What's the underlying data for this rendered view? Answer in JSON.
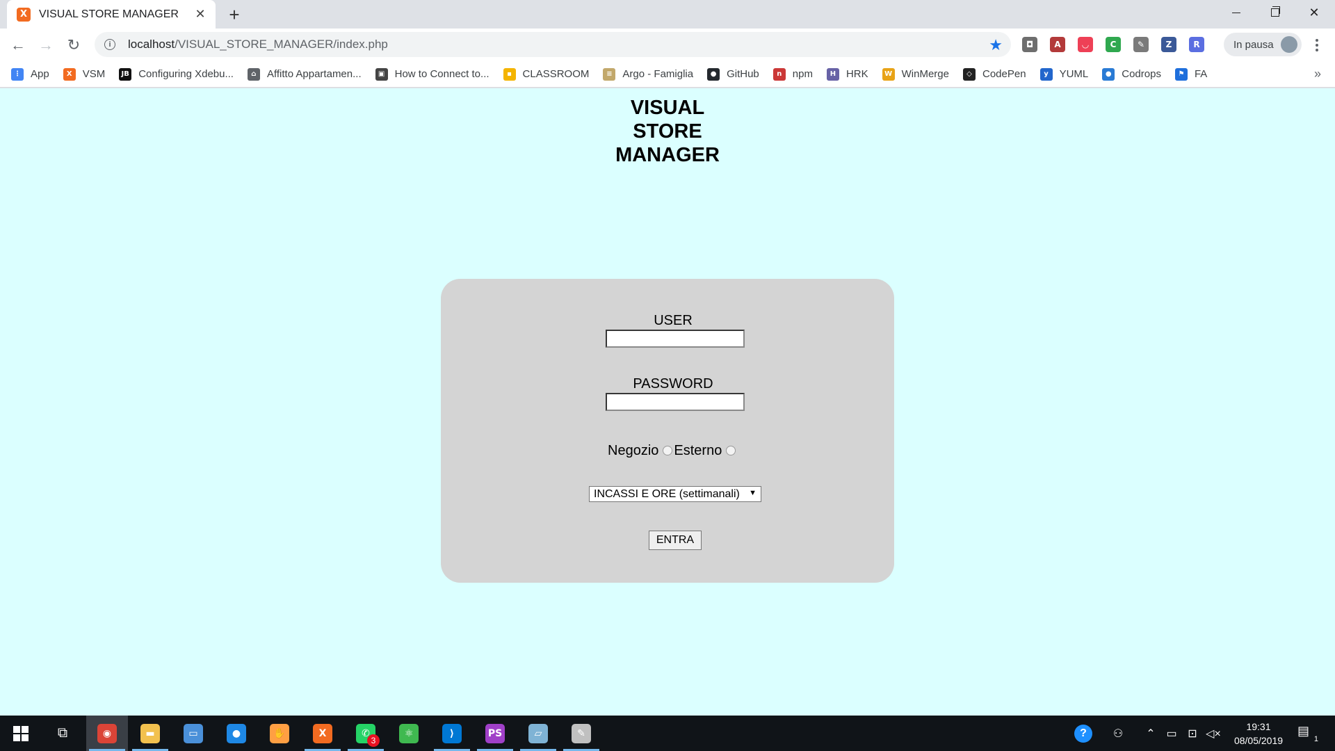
{
  "browser": {
    "tab_title": "VISUAL STORE MANAGER",
    "tab_favicon_letter": "X",
    "url_host": "localhost",
    "url_path": "/VISUAL_STORE_MANAGER/index.php",
    "profile_label": "In pausa",
    "extensions": [
      {
        "name": "camera-extension-icon",
        "glyph": "◘",
        "color": "#6e6e6e"
      },
      {
        "name": "pdf-extension-icon",
        "glyph": "A",
        "color": "#b33a3a"
      },
      {
        "name": "pocket-extension-icon",
        "glyph": "◡",
        "color": "#ee4056"
      },
      {
        "name": "cors-extension-icon",
        "glyph": "C",
        "color": "#2fa84f"
      },
      {
        "name": "tools-extension-icon",
        "glyph": "✎",
        "color": "#7a7a7a"
      },
      {
        "name": "zotero-extension-icon",
        "glyph": "Z",
        "color": "#3b5998"
      },
      {
        "name": "react-extension-icon",
        "glyph": "R",
        "color": "#5b6ee1"
      }
    ]
  },
  "bookmarks": [
    {
      "label": "App",
      "icon": "apps-grid-icon",
      "color": "#4285f4",
      "glyph": "⋮"
    },
    {
      "label": "VSM",
      "icon": "xampp-icon",
      "color": "#f26b21",
      "glyph": "X"
    },
    {
      "label": "Configuring Xdebu...",
      "icon": "jetbrains-icon",
      "color": "#111111",
      "glyph": "JB"
    },
    {
      "label": "Affitto Appartamen...",
      "icon": "house-icon",
      "color": "#5f6368",
      "glyph": "⌂"
    },
    {
      "label": "How to Connect to...",
      "icon": "floppy-icon",
      "color": "#444444",
      "glyph": "▣"
    },
    {
      "label": "CLASSROOM",
      "icon": "classroom-icon",
      "color": "#f4b400",
      "glyph": "▪"
    },
    {
      "label": "Argo - Famiglia",
      "icon": "argo-icon",
      "color": "#c2a86b",
      "glyph": "≡"
    },
    {
      "label": "GitHub",
      "icon": "github-icon",
      "color": "#24292e",
      "glyph": "●"
    },
    {
      "label": "npm",
      "icon": "npm-icon",
      "color": "#cb3837",
      "glyph": "n"
    },
    {
      "label": "HRK",
      "icon": "heroku-icon",
      "color": "#6762a6",
      "glyph": "H"
    },
    {
      "label": "WinMerge",
      "icon": "winmerge-icon",
      "color": "#e8a317",
      "glyph": "W"
    },
    {
      "label": "CodePen",
      "icon": "codepen-icon",
      "color": "#222222",
      "glyph": "◇"
    },
    {
      "label": "YUML",
      "icon": "yuml-icon",
      "color": "#2266cc",
      "glyph": "y"
    },
    {
      "label": "Codrops",
      "icon": "codrops-icon",
      "color": "#2a7bd5",
      "glyph": "●"
    },
    {
      "label": "FA",
      "icon": "flag-icon",
      "color": "#1f6fdc",
      "glyph": "⚑"
    }
  ],
  "page": {
    "title_lines": [
      "VISUAL",
      "STORE",
      "MANAGER"
    ],
    "user_label": "USER",
    "password_label": "PASSWORD",
    "user_value": "",
    "password_value": "",
    "radio_negozio": "Negozio",
    "radio_esterno": "Esterno",
    "select_value": "INCASSI E ORE (settimanali)",
    "submit_label": "ENTRA"
  },
  "taskbar": {
    "apps": [
      {
        "name": "chrome-taskbar-icon",
        "color": "#db4437",
        "glyph": "◉",
        "active": true,
        "running": true
      },
      {
        "name": "explorer-taskbar-icon",
        "color": "#f2c14e",
        "glyph": "▬",
        "active": false,
        "running": true
      },
      {
        "name": "computer-taskbar-icon",
        "color": "#4a90d9",
        "glyph": "▭",
        "active": false,
        "running": false
      },
      {
        "name": "messenger-taskbar-icon",
        "color": "#1e88e5",
        "glyph": "●",
        "active": false,
        "running": false
      },
      {
        "name": "hand-app-taskbar-icon",
        "color": "#ff9f43",
        "glyph": "✋",
        "active": false,
        "running": false
      },
      {
        "name": "xampp-taskbar-icon",
        "color": "#f26b21",
        "glyph": "X",
        "active": false,
        "running": true
      },
      {
        "name": "whatsapp-taskbar-icon",
        "color": "#25d366",
        "glyph": "✆",
        "active": false,
        "running": true,
        "badge": "3"
      },
      {
        "name": "atom-taskbar-icon",
        "color": "#3fb950",
        "glyph": "⚛",
        "active": false,
        "running": false
      },
      {
        "name": "vscode-taskbar-icon",
        "color": "#0078d4",
        "glyph": "⟩",
        "active": false,
        "running": true
      },
      {
        "name": "phpstorm-taskbar-icon",
        "color": "#a040c8",
        "glyph": "PS",
        "active": false,
        "running": true
      },
      {
        "name": "notes-taskbar-icon",
        "color": "#7fb3d5",
        "glyph": "▱",
        "active": false,
        "running": true
      },
      {
        "name": "paint-taskbar-icon",
        "color": "#c0c0c0",
        "glyph": "✎",
        "active": false,
        "running": true
      }
    ],
    "clock_time": "19:31",
    "clock_date": "08/05/2019",
    "notification_count": "1"
  }
}
